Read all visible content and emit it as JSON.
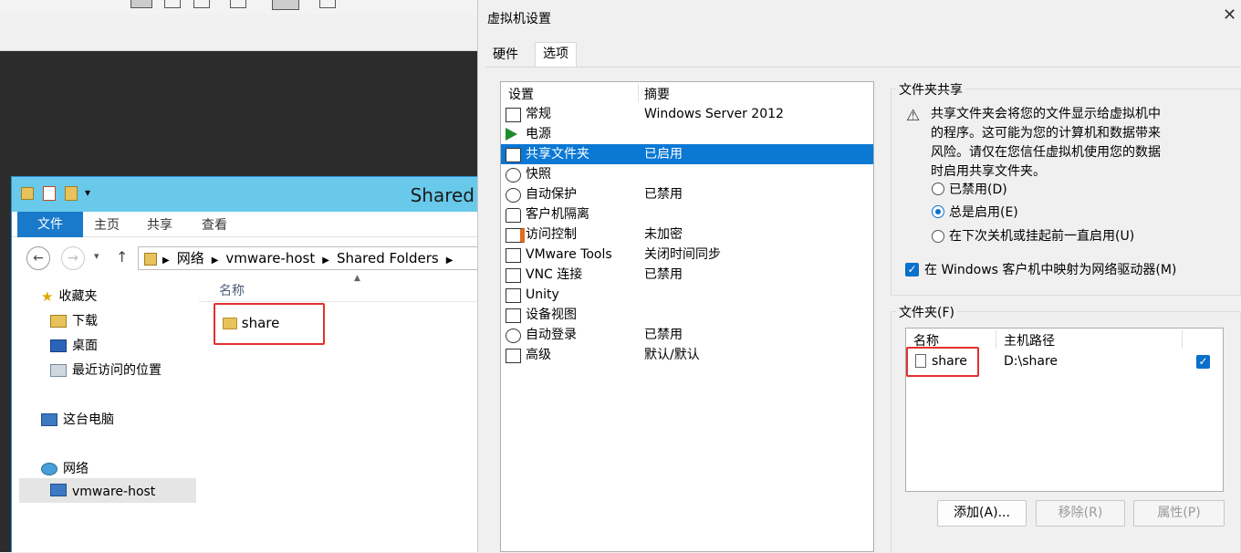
{
  "explorer": {
    "title": "Shared",
    "ribbon_tabs": [
      "文件",
      "主页",
      "共享",
      "查看"
    ],
    "breadcrumb": [
      "网络",
      "vmware-host",
      "Shared Folders"
    ],
    "nav": {
      "favorites": "收藏夹",
      "downloads": "下载",
      "desktop": "桌面",
      "recent": "最近访问的位置",
      "this_pc": "这台电脑",
      "network": "网络",
      "vmware_host": "vmware-host"
    },
    "column_name": "名称",
    "items": [
      "share"
    ]
  },
  "dialog": {
    "title": "虚拟机设置",
    "tabs": [
      "硬件",
      "选项"
    ],
    "settings_header": "设置",
    "summary_header": "摘要",
    "settings": [
      {
        "name": "常规",
        "summary": "Windows Server 2012",
        "icon": "monitor-icon"
      },
      {
        "name": "电源",
        "summary": "",
        "icon": "power-play-icon"
      },
      {
        "name": "共享文件夹",
        "summary": "已启用",
        "icon": "shared-folder-icon",
        "selected": true
      },
      {
        "name": "快照",
        "summary": "",
        "icon": "snapshot-clock-icon"
      },
      {
        "name": "自动保护",
        "summary": "已禁用",
        "icon": "autoprotect-clock-icon"
      },
      {
        "name": "客户机隔离",
        "summary": "",
        "icon": "lock-icon"
      },
      {
        "name": "访问控制",
        "summary": "未加密",
        "icon": "access-control-icon"
      },
      {
        "name": "VMware Tools",
        "summary": "关闭时间同步",
        "icon": "vm-icon"
      },
      {
        "name": "VNC 连接",
        "summary": "已禁用",
        "icon": "vnc-icon"
      },
      {
        "name": "Unity",
        "summary": "",
        "icon": "unity-icon"
      },
      {
        "name": "设备视图",
        "summary": "",
        "icon": "device-view-icon"
      },
      {
        "name": "自动登录",
        "summary": "已禁用",
        "icon": "autologin-icon"
      },
      {
        "name": "高级",
        "summary": "默认/默认",
        "icon": "advanced-icon"
      }
    ],
    "folder_sharing": {
      "legend": "文件夹共享",
      "warning_lines": [
        "共享文件夹会将您的文件显示给虚拟机中",
        "的程序。这可能为您的计算机和数据带来",
        "风险。请仅在您信任虚拟机使用您的数据",
        "时启用共享文件夹。"
      ],
      "radio_disabled": "已禁用(D)",
      "radio_always": "总是启用(E)",
      "radio_until": "在下次关机或挂起前一直启用(U)",
      "selected": "总是启用(E)",
      "map_drive": "在 Windows 客户机中映射为网络驱动器(M)",
      "map_drive_checked": true
    },
    "folders": {
      "legend": "文件夹(F)",
      "col_name": "名称",
      "col_path": "主机路径",
      "rows": [
        {
          "name": "share",
          "path": "D:\\share",
          "checked": true
        }
      ]
    },
    "buttons": {
      "add": "添加(A)...",
      "remove": "移除(R)",
      "properties": "属性(P)"
    }
  }
}
